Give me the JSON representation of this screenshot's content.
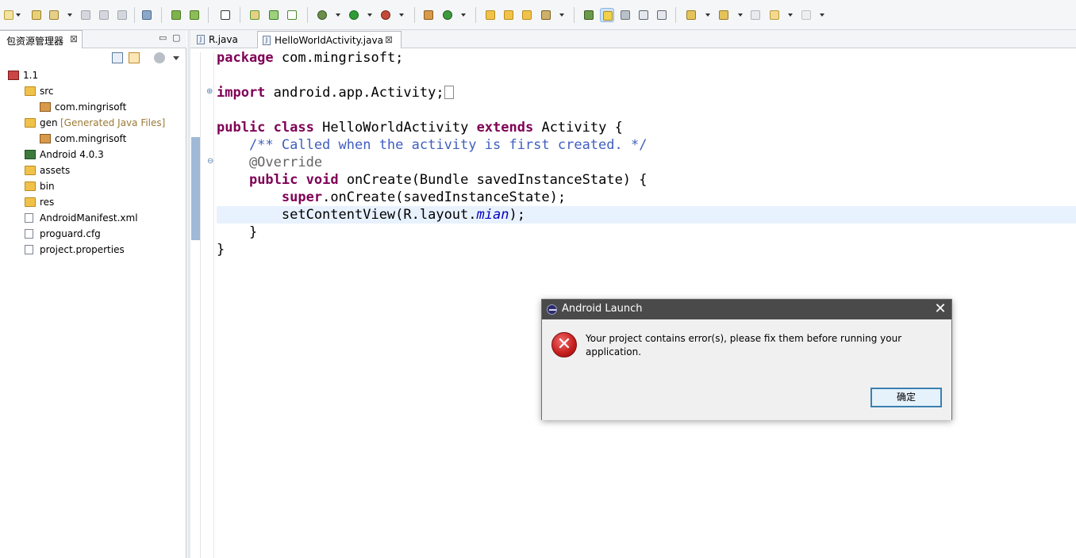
{
  "toolbar": {
    "highlight_color": "#cfe3f6"
  },
  "package_explorer": {
    "tab_label": "包资源管理器",
    "close_glyph": "⊠",
    "minimize_glyph": "▭",
    "maximize_glyph": "▢",
    "tree": [
      {
        "label": "1.1",
        "icon": "android-project-icon",
        "level": 0
      },
      {
        "label": "src",
        "icon": "source-folder-icon",
        "level": 1
      },
      {
        "label": "com.mingrisoft",
        "icon": "package-icon",
        "level": 2
      },
      {
        "label": "gen",
        "decoration": "[Generated Java Files]",
        "icon": "source-folder-icon",
        "level": 1
      },
      {
        "label": "com.mingrisoft",
        "icon": "package-icon",
        "level": 2
      },
      {
        "label": "Android 4.0.3",
        "icon": "library-icon",
        "level": 1
      },
      {
        "label": "assets",
        "icon": "folder-icon",
        "level": 1
      },
      {
        "label": "bin",
        "icon": "folder-icon",
        "level": 1
      },
      {
        "label": "res",
        "icon": "folder-icon",
        "level": 1
      },
      {
        "label": "AndroidManifest.xml",
        "icon": "xml-file-icon",
        "level": 1
      },
      {
        "label": "proguard.cfg",
        "icon": "file-icon",
        "level": 1
      },
      {
        "label": "project.properties",
        "icon": "file-icon",
        "level": 1
      }
    ]
  },
  "editor": {
    "tabs": [
      {
        "label": "R.java",
        "active": false
      },
      {
        "label": "HelloWorldActivity.java",
        "active": true
      }
    ],
    "tab_close_glyph": "⊠",
    "code": {
      "package_kw": "package",
      "package_name": " com.mingrisoft;",
      "import_kw": "import",
      "import_name": " android.app.Activity;",
      "public_kw": "public",
      "class_kw": "class",
      "class_name": " HelloWorldActivity ",
      "extends_kw": "extends",
      "super_class": " Activity {",
      "comment": "    /** Called when the activity is first created. */",
      "annotation": "    @Override",
      "void_kw": "void",
      "method_sig": " onCreate(Bundle savedInstanceState) {",
      "super_kw": "super",
      "super_call": ".onCreate(savedInstanceState);",
      "setcontent_pre": "        setContentView(R.layout.",
      "field": "mian",
      "setcontent_post": ");",
      "close_method": "    }",
      "close_class": "}",
      "fold_expand": "⊕",
      "fold_collapse": "⊖"
    },
    "colors": {
      "keyword": "#7f0055",
      "comment": "#3f5fbf",
      "annotation": "#646464",
      "field": "#0000c0",
      "current_line": "#e8f2fe"
    }
  },
  "dialog": {
    "title": "Android Launch",
    "close_glyph": "✕",
    "message": "Your project contains error(s), please fix them before running your application.",
    "error_glyph": "✕",
    "ok_label": "确定"
  }
}
